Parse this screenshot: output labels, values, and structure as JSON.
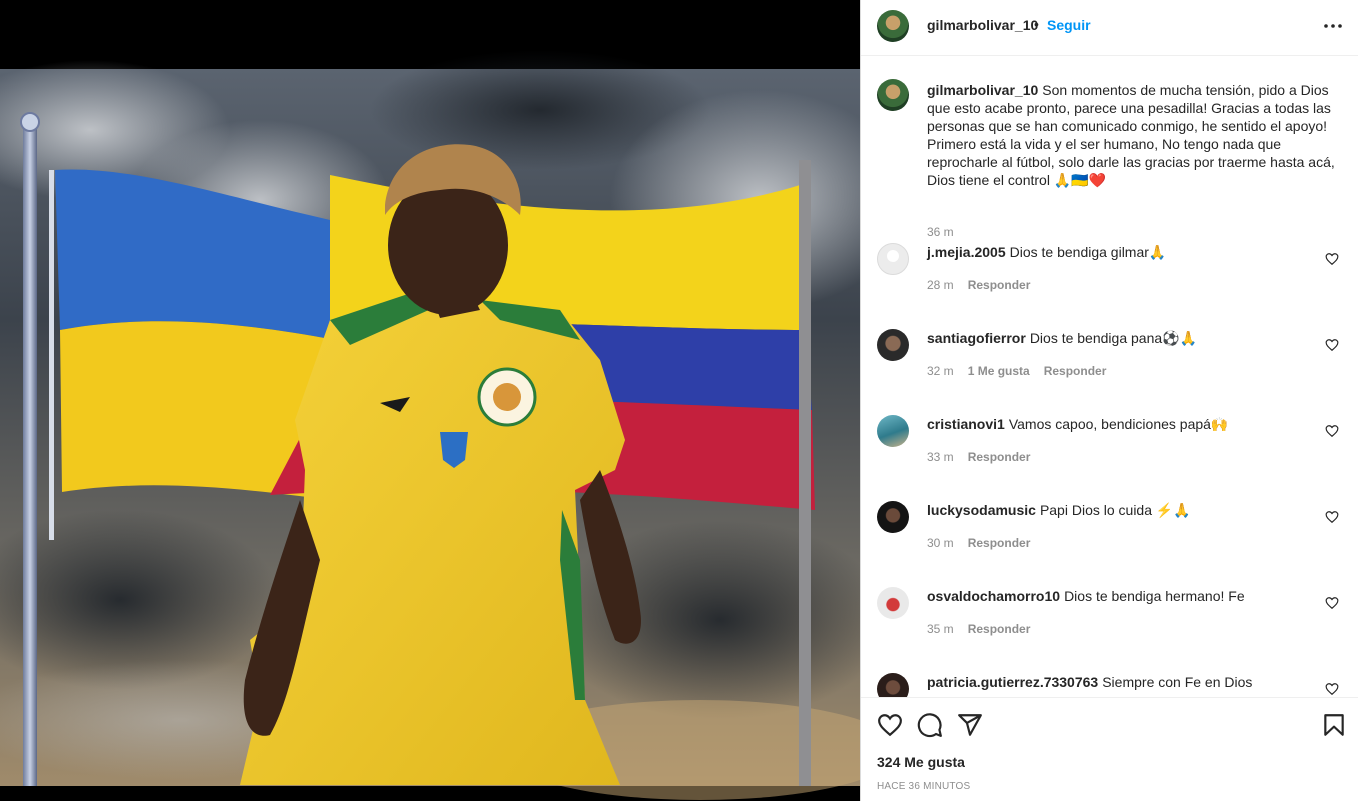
{
  "post": {
    "username": "gilmarbolivar_10",
    "follow_label": "Seguir",
    "dot": "•",
    "caption": "Son momentos de mucha tensión, pido a Dios que esto acabe pronto, parece una pesadilla! Gracias a todas las personas que se han comunicado conmigo, he sentido el apoyo! Primero está la vida y el ser humano, No tengo nada que reprocharle al fútbol, solo darle las gracias por traerme hasta acá, Dios tiene el control 🙏🇺🇦❤️",
    "caption_time": "36 m",
    "likes": "324 Me gusta",
    "posted_ago": "HACE 36 MINUTOS"
  },
  "comments": [
    {
      "username": "j.mejia.2005",
      "text": "Dios te bendiga gilmar🙏",
      "time": "28 m",
      "likes": "",
      "reply": "Responder"
    },
    {
      "username": "santiagofierror",
      "text": "Dios te bendiga pana⚽🙏",
      "time": "32 m",
      "likes": "1 Me gusta",
      "reply": "Responder"
    },
    {
      "username": "cristianovi1",
      "text": "Vamos capoo, bendiciones papá🙌",
      "time": "33 m",
      "likes": "",
      "reply": "Responder"
    },
    {
      "username": "luckysodamusic",
      "text": "Papi Dios lo cuida ⚡🙏",
      "time": "30 m",
      "likes": "",
      "reply": "Responder"
    },
    {
      "username": "osvaldochamorro10",
      "text": "Dios te bendiga hermano! Fe",
      "time": "35 m",
      "likes": "",
      "reply": "Responder"
    },
    {
      "username": "patricia.gutierrez.7330763",
      "text": "Siempre con Fe en Dios",
      "time": "",
      "likes": "",
      "reply": ""
    }
  ],
  "colors": {
    "link": "#0095f6",
    "text": "#262626",
    "muted": "#8e8e8e"
  },
  "icons": [
    "more-options-icon",
    "heart-icon",
    "comment-icon",
    "share-icon",
    "bookmark-icon"
  ]
}
